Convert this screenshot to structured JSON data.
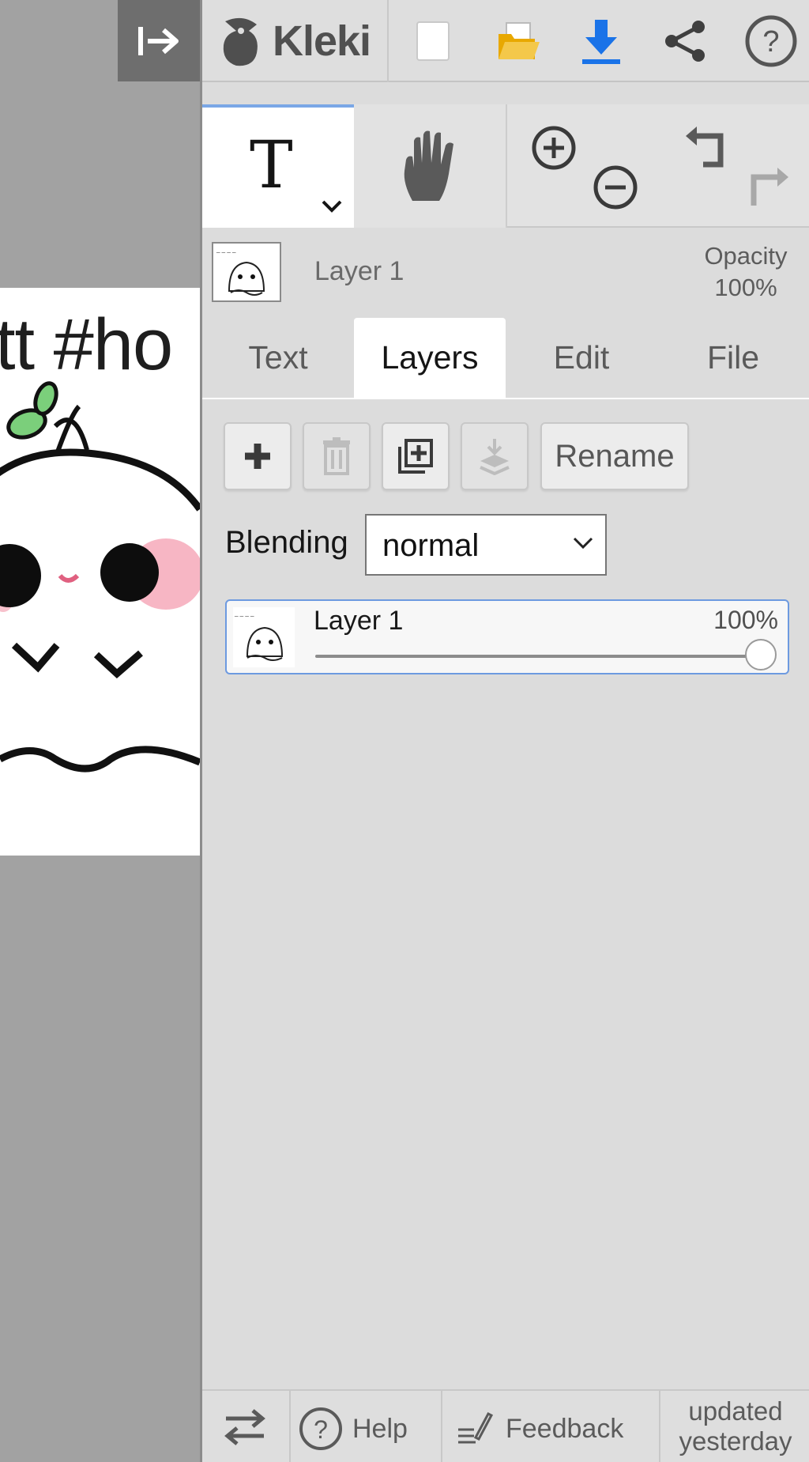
{
  "app": {
    "name": "Kleki"
  },
  "canvas": {
    "document_text": "tt #ho"
  },
  "toolbar": {
    "new_icon": "new-file-icon",
    "open_icon": "folder-open-icon",
    "save_icon": "download-icon",
    "share_icon": "share-icon",
    "help_icon": "help-circle-icon",
    "colors": {
      "download": "#1a73e8",
      "folder": "#f4b400",
      "active_tool_indicator": "#7aa7e6"
    }
  },
  "tools": {
    "active": "text",
    "text_glyph": "T",
    "icons": [
      "text-tool-icon",
      "hand-tool-icon",
      "zoom-in-icon",
      "zoom-out-icon",
      "undo-icon",
      "redo-icon"
    ]
  },
  "layer_info": {
    "name": "Layer 1",
    "opacity_label": "Opacity",
    "opacity_value": "100%"
  },
  "tabs": [
    {
      "label": "Text",
      "active": false
    },
    {
      "label": "Layers",
      "active": true
    },
    {
      "label": "Edit",
      "active": false
    },
    {
      "label": "File",
      "active": false
    }
  ],
  "layer_actions": {
    "add_icon": "plus-icon",
    "delete_icon": "trash-icon",
    "duplicate_icon": "duplicate-icon",
    "merge_icon": "merge-down-icon",
    "rename_label": "Rename"
  },
  "blending": {
    "label": "Blending",
    "value": "normal"
  },
  "layers": [
    {
      "name": "Layer 1",
      "opacity_text": "100%",
      "opacity": 1.0
    }
  ],
  "bottom": {
    "swap_icon": "swap-arrows-icon",
    "help_label": "Help",
    "feedback_label": "Feedback",
    "updated_line1": "updated",
    "updated_line2": "yesterday"
  }
}
